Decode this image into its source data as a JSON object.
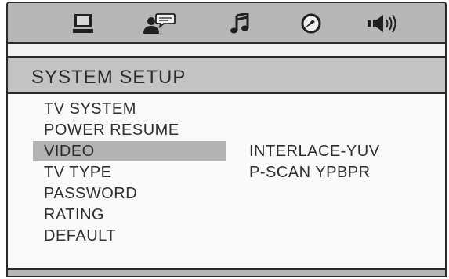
{
  "tabs": [
    {
      "icon": "monitor-icon"
    },
    {
      "icon": "speaker-person-icon"
    },
    {
      "icon": "music-note-icon"
    },
    {
      "icon": "dial-icon"
    },
    {
      "icon": "volume-icon"
    }
  ],
  "title": "SYSTEM SETUP",
  "menu": {
    "items": [
      "TV SYSTEM",
      "POWER RESUME",
      "VIDEO",
      "TV TYPE",
      "PASSWORD",
      "RATING",
      "DEFAULT"
    ],
    "selected": "VIDEO"
  },
  "submenu": {
    "items": [
      "INTERLACE-YUV",
      "P-SCAN YPBPR"
    ]
  },
  "colors": {
    "tab_bar": "#b7b7b7",
    "title_bar": "#c3c3c3",
    "selection": "#b3b3b3",
    "text": "#2e2e2e"
  }
}
